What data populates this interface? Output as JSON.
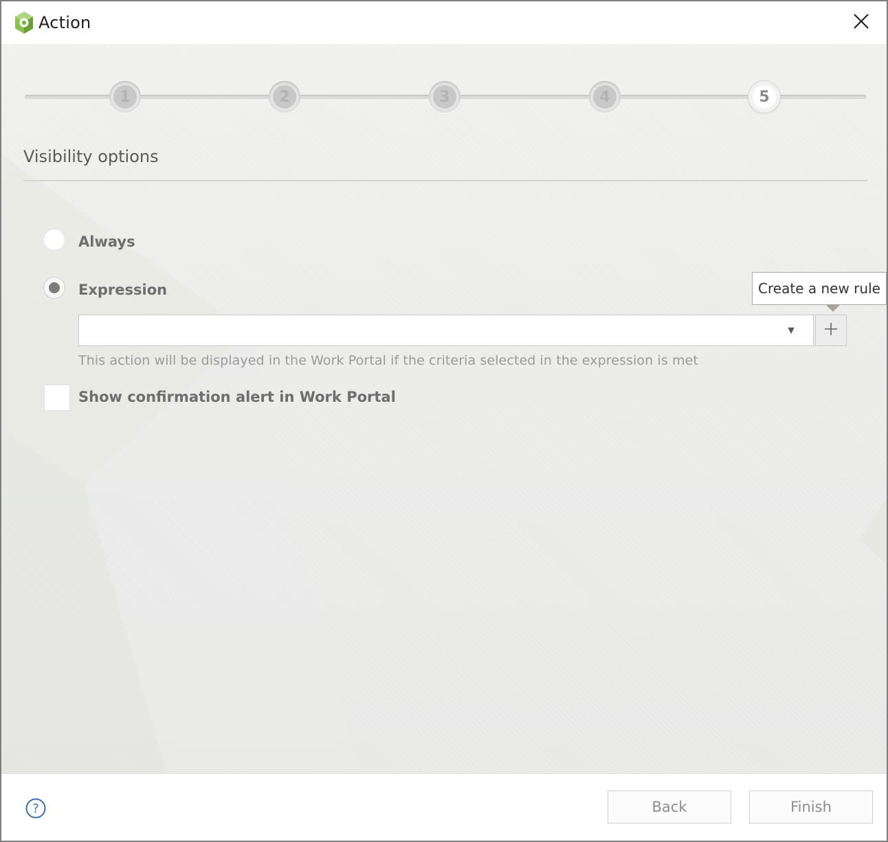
{
  "window": {
    "title": "Action",
    "icons": {
      "app": "bizagi-logo-icon",
      "close": "close-icon"
    }
  },
  "wizard": {
    "steps": [
      {
        "label": "1",
        "active": false
      },
      {
        "label": "2",
        "active": false
      },
      {
        "label": "3",
        "active": false
      },
      {
        "label": "4",
        "active": false
      },
      {
        "label": "5",
        "active": true
      }
    ]
  },
  "section": {
    "title": "Visibility options"
  },
  "visibility": {
    "options": [
      {
        "label": "Always",
        "selected": false
      },
      {
        "label": "Expression",
        "selected": true
      }
    ],
    "expression": {
      "value": "",
      "hint": "This action will be displayed in the Work Portal if the criteria selected in the expression is met",
      "add_button_icon": "plus-icon",
      "tooltip": "Create a new rule"
    }
  },
  "confirmation": {
    "label": "Show confirmation alert in Work Portal",
    "checked": false
  },
  "footer": {
    "help_icon": "help-icon",
    "back_label": "Back",
    "finish_label": "Finish"
  },
  "colors": {
    "accent": "#7cb342",
    "text_muted": "#6e6e6e"
  }
}
